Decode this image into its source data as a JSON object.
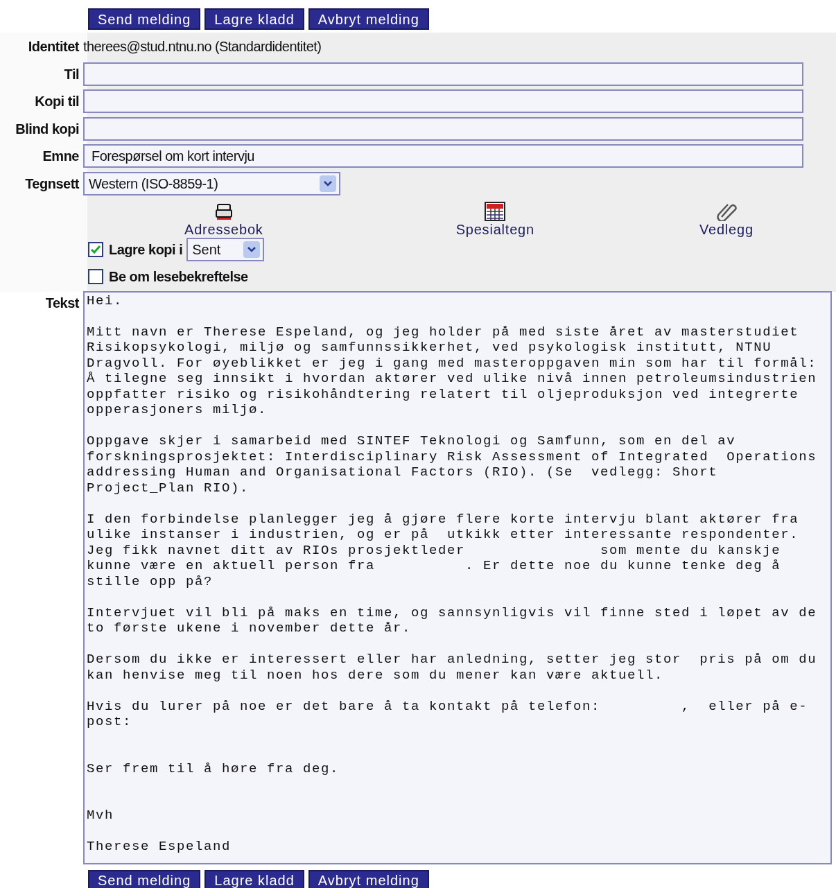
{
  "buttons_top": [
    "Send melding",
    "Lagre kladd",
    "Avbryt melding"
  ],
  "identity": {
    "label": "Identitet",
    "value": "therees@stud.ntnu.no (Standardidentitet)"
  },
  "fields": [
    {
      "label": "Til"
    },
    {
      "label": "Kopi til"
    },
    {
      "label": "Blind kopi"
    },
    {
      "label": "Emne",
      "value": "Forespørsel om kort intervju"
    }
  ],
  "charset": {
    "label": "Tegnsett",
    "value": "Western (ISO-8859-1)"
  },
  "tools": [
    {
      "kind": "addressbook",
      "label": "Adressebok"
    },
    {
      "kind": "specialchars",
      "label": "Spesialtegn"
    },
    {
      "kind": "attachment",
      "label": "Vedlegg"
    }
  ],
  "options": [
    {
      "kind": "select",
      "label": "Lagre kopi i",
      "checked": true,
      "select_value": "Sent"
    },
    {
      "kind": "plain",
      "label": "Be om lesebekreftelse",
      "checked": false
    }
  ],
  "body": {
    "label": "Tekst",
    "paragraphs": [
      {
        "kind": "first",
        "lines": [
          "Hei."
        ]
      },
      {
        "kind": "gap",
        "lines": [
          "Mitt navn er Therese Espeland, og jeg holder på med siste året av masterstudiet",
          "Risikopsykologi, miljø og samfunnssikkerhet, ved psykologisk institutt, NTNU",
          "Dragvoll. For øyeblikket er jeg i gang med masteroppgaven min som har til formål:",
          "Å tilegne seg innsikt i hvordan aktører ved ulike nivå innen petroleumsindustrien",
          "oppfatter risiko og risikohåndtering relatert til oljeproduksjon ved integrerte",
          "opperasjoners miljø."
        ]
      },
      {
        "kind": "gap",
        "lines": [
          "Oppgave skjer i samarbeid med SINTEF Teknologi og Samfunn, som en del av",
          "forskningsprosjektet: Interdisciplinary Risk Assessment of Integrated  Operations",
          "addressing Human and Organisational Factors (RIO). (Se  vedlegg: Short",
          "Project_Plan RIO)."
        ]
      },
      {
        "kind": "gap",
        "lines": [
          "I den forbindelse planlegger jeg å gjøre flere korte intervju blant aktører fra",
          "ulike instanser i industrien, og er på  utkikk etter interessante respondenter.",
          "Jeg fikk navnet ditt av RIOs prosjektleder               som mente du kanskje",
          "kunne være en aktuell person fra          . Er dette noe du kunne tenke deg å",
          "stille opp på?"
        ]
      },
      {
        "kind": "gap",
        "lines": [
          "Intervjuet vil bli på maks en time, og sannsynligvis vil finne sted i løpet av de",
          "to første ukene i november dette år."
        ]
      },
      {
        "kind": "gap",
        "lines": [
          "Dersom du ikke er interessert eller har anledning, setter jeg stor  pris på om du",
          "kan henvise meg til noen hos dere som du mener kan være aktuell."
        ]
      },
      {
        "kind": "gap",
        "lines": [
          "Hvis du lurer på noe er det bare å ta kontakt på telefon:         ,  eller på e-",
          "post:"
        ]
      },
      {
        "kind": "wide_gap",
        "lines": [
          "Ser frem til å høre fra deg."
        ]
      },
      {
        "kind": "wide_gap",
        "lines": [
          "Mvh"
        ]
      },
      {
        "kind": "gap",
        "lines": [
          "Therese Espeland"
        ]
      }
    ]
  },
  "buttons_bottom": [
    "Send melding",
    "Lagre kladd",
    "Avbryt melding"
  ]
}
